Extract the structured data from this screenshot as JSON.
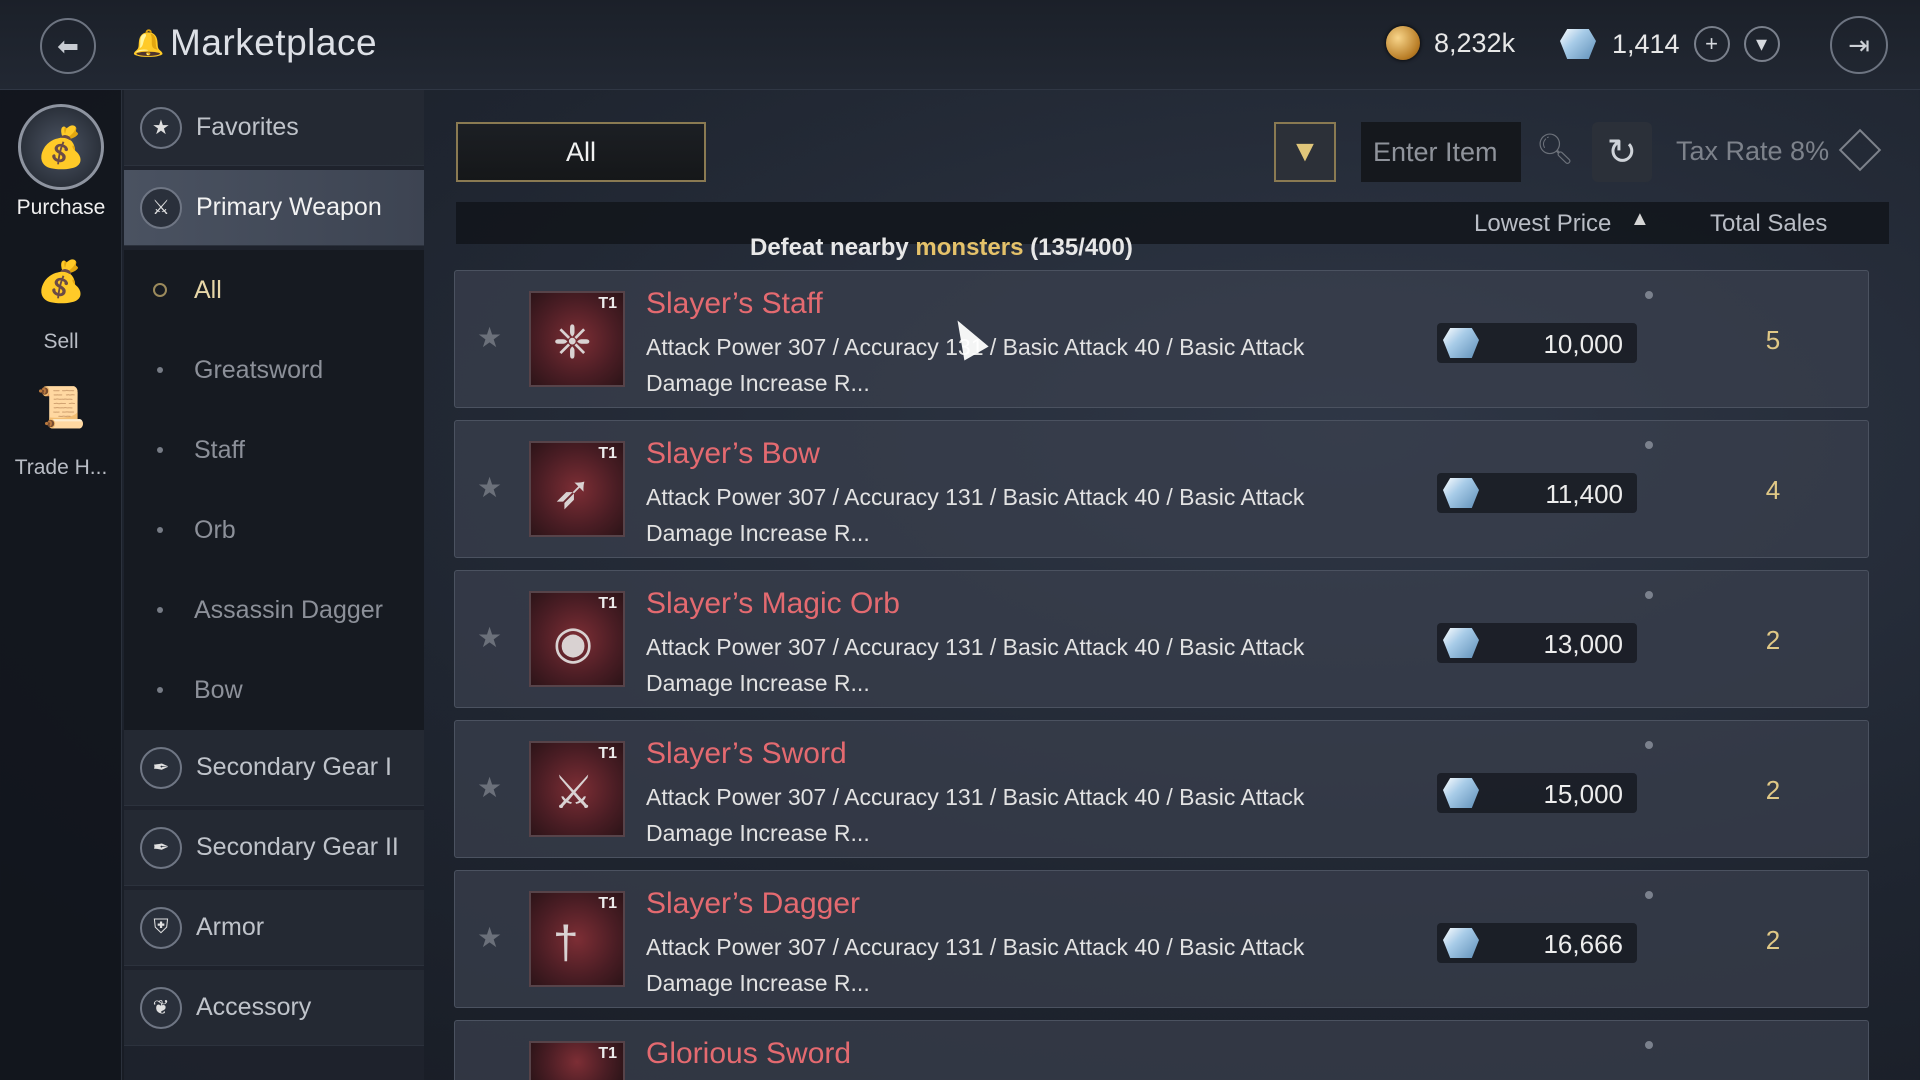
{
  "header": {
    "title": "Marketplace",
    "gold": "8,232k",
    "gems": "1,414"
  },
  "rail": [
    {
      "label": "Purchase",
      "icon": "money-bag-down-icon",
      "active": true
    },
    {
      "label": "Sell",
      "icon": "money-bag-up-icon",
      "active": false
    },
    {
      "label": "Trade H...",
      "icon": "trade-history-icon",
      "active": false
    }
  ],
  "categories": {
    "favorites": "Favorites",
    "primary_weapon": "Primary Weapon",
    "subs": [
      "All",
      "Greatsword",
      "Staff",
      "Orb",
      "Assassin Dagger",
      "Bow"
    ],
    "secondary_gear_1": "Secondary Gear I",
    "secondary_gear_2": "Secondary Gear II",
    "armor": "Armor",
    "accessory": "Accessory"
  },
  "toolbar": {
    "all_label": "All",
    "search_placeholder": "Enter Item",
    "tax_rate": "Tax Rate 8%"
  },
  "columns": {
    "lowest_price": "Lowest Price",
    "total_sales": "Total Sales"
  },
  "quest": {
    "prefix": "Defeat nearby",
    "highlight": "monsters",
    "progress": "(135/400)"
  },
  "items": [
    {
      "name": "Slayer’s Staff",
      "tier": "T1",
      "desc": "Attack Power 307 / Accuracy 131 / Basic Attack 40 / Basic Attack Damage Increase R...",
      "price": "10,000",
      "sales": "5"
    },
    {
      "name": "Slayer’s Bow",
      "tier": "T1",
      "desc": "Attack Power 307 / Accuracy 131 / Basic Attack 40 / Basic Attack Damage Increase R...",
      "price": "11,400",
      "sales": "4"
    },
    {
      "name": "Slayer’s Magic Orb",
      "tier": "T1",
      "desc": "Attack Power 307 / Accuracy 131 / Basic Attack 40 / Basic Attack Damage Increase R...",
      "price": "13,000",
      "sales": "2"
    },
    {
      "name": "Slayer’s Sword",
      "tier": "T1",
      "desc": "Attack Power 307 / Accuracy 131 / Basic Attack 40 / Basic Attack Damage Increase R...",
      "price": "15,000",
      "sales": "2"
    },
    {
      "name": "Slayer’s Dagger",
      "tier": "T1",
      "desc": "Attack Power 307 / Accuracy 131 / Basic Attack 40 / Basic Attack Damage Increase R...",
      "price": "16,666",
      "sales": "2"
    },
    {
      "name": "Glorious Sword",
      "tier": "T1",
      "desc": "",
      "price": "",
      "sales": ""
    }
  ]
}
